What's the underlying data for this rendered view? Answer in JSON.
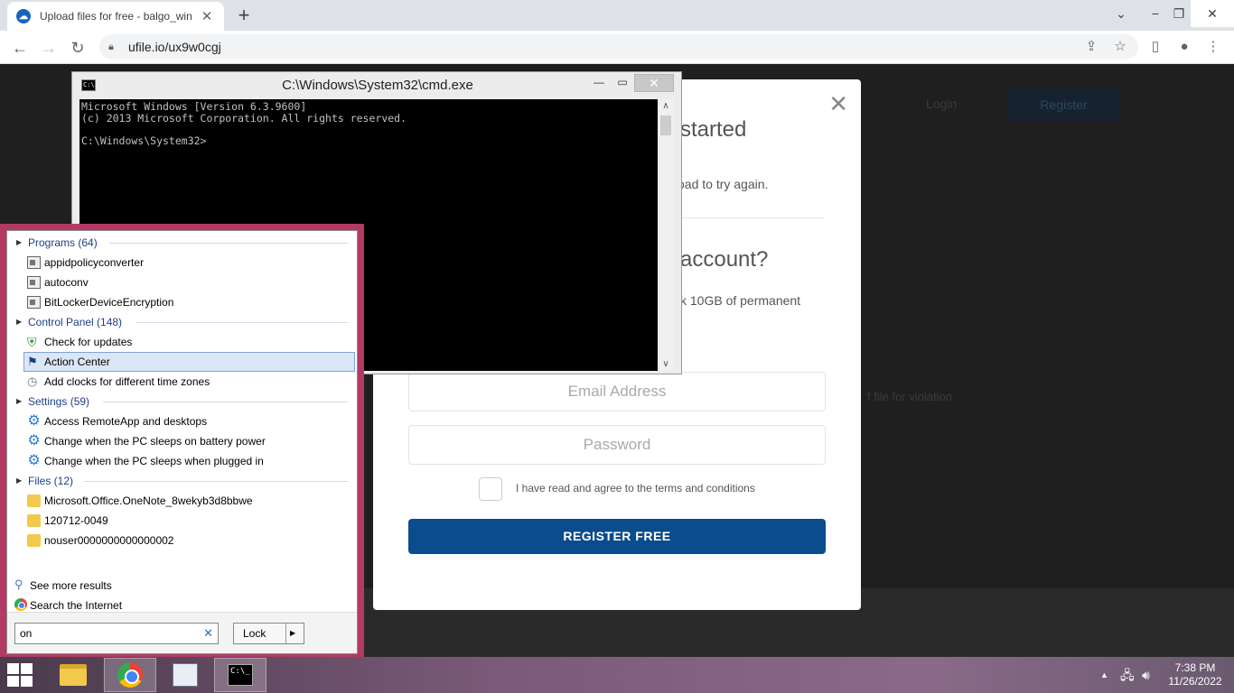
{
  "browser": {
    "tab_title": "Upload files for free - balgo_win",
    "tab_favicon": "cloud-icon",
    "url": "ufile.io/ux9w0cgj"
  },
  "page": {
    "login_label": "Login",
    "register_label": "Register",
    "bg_text": "f file for violation",
    "modal": {
      "heading1": "started",
      "text1": "oad to try again.",
      "heading2": "account?",
      "text2": "ck 10GB of permanent",
      "email_placeholder": "Email Address",
      "password_placeholder": "Password",
      "terms": "I have read and agree to the terms and conditions",
      "button": "REGISTER FREE"
    }
  },
  "cmd": {
    "title": "C:\\Windows\\System32\\cmd.exe",
    "icon_text": "C:\\",
    "lines": "Microsoft Windows [Version 6.3.9600]\n(c) 2013 Microsoft Corporation. All rights reserved.\n\nC:\\Windows\\System32>"
  },
  "start_search": {
    "groups": [
      {
        "label": "Programs (64)",
        "items": [
          {
            "label": "appidpolicyconverter",
            "icon": "app-icon"
          },
          {
            "label": "autoconv",
            "icon": "app-icon"
          },
          {
            "label": "BitLockerDeviceEncryption",
            "icon": "app-icon"
          }
        ]
      },
      {
        "label": "Control Panel (148)",
        "items": [
          {
            "label": "Check for updates",
            "icon": "shield-icon"
          },
          {
            "label": "Action Center",
            "icon": "flag-icon",
            "selected": true
          },
          {
            "label": "Add clocks for different time zones",
            "icon": "clock-icon"
          }
        ]
      },
      {
        "label": "Settings (59)",
        "items": [
          {
            "label": "Access RemoteApp and desktops",
            "icon": "gear-icon"
          },
          {
            "label": "Change when the PC sleeps on battery power",
            "icon": "gear-icon"
          },
          {
            "label": "Change when the PC sleeps when plugged in",
            "icon": "gear-icon"
          }
        ]
      },
      {
        "label": "Files (12)",
        "items": [
          {
            "label": "Microsoft.Office.OneNote_8wekyb3d8bbwe",
            "icon": "folder-icon"
          },
          {
            "label": "120712-0049",
            "icon": "folder-icon"
          },
          {
            "label": "nouser0000000000000002",
            "icon": "folder-icon"
          }
        ]
      }
    ],
    "see_more": "See more results",
    "search_internet": "Search the Internet",
    "query": "on",
    "lock_label": "Lock"
  },
  "taskbar": {
    "time": "7:38 PM",
    "date": "11/26/2022",
    "cmd_icon_text": "C:\\_"
  },
  "colors": {
    "start_border": "#b23a64",
    "register_button": "#0b4c8c",
    "category_text": "#1e3f87"
  }
}
